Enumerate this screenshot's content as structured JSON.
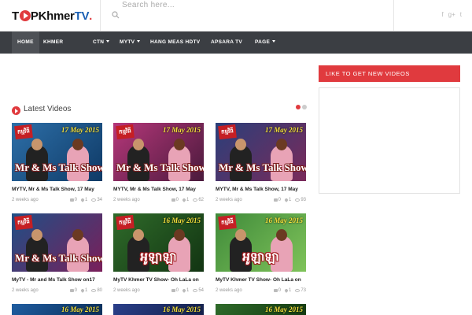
{
  "header": {
    "logo": {
      "part1": "T",
      "part2": "PKhmer",
      "part3": "TV",
      "part4": "."
    },
    "search_placeholder": "Search here...",
    "social": [
      "f",
      "g+",
      "t"
    ]
  },
  "nav": [
    {
      "label": "HOME",
      "active": true,
      "caret": false
    },
    {
      "label": "KHMER",
      "active": false,
      "caret": false
    },
    {
      "label": "CTN",
      "active": false,
      "caret": true
    },
    {
      "label": "MYTV",
      "active": false,
      "caret": true
    },
    {
      "label": "HANG MEAS HDTV",
      "active": false,
      "caret": false
    },
    {
      "label": "APSARA TV",
      "active": false,
      "caret": false
    },
    {
      "label": "PAGE",
      "active": false,
      "caret": true
    }
  ],
  "sidebar": {
    "widget_title": "LIKE TO GET NEW VIDEOS"
  },
  "latest": {
    "title": "Latest Videos",
    "videos": [
      {
        "title": "MYTV, Mr & Ms Talk Show, 17 May",
        "time": "2 weeks ago",
        "comments": "0",
        "likes": "1",
        "views": "34",
        "thumb_date": "17 May 2015",
        "thumb_text": "Mr & Ms Talk Show",
        "thumb_badge": "កម្មវិធី",
        "bg": "#2d6fa8",
        "bg2": "#0f3a66"
      },
      {
        "title": "MYTV, Mr & Ms Talk Show, 17 May",
        "time": "2 weeks ago",
        "comments": "0",
        "likes": "1",
        "views": "62",
        "thumb_date": "17 May 2015",
        "thumb_text": "Mr & Ms Talk Show",
        "thumb_badge": "កម្មវិធី",
        "bg": "#b5377a",
        "bg2": "#4a1a3c"
      },
      {
        "title": "MYTV, Mr & Ms Talk Show, 17 May",
        "time": "2 weeks ago",
        "comments": "0",
        "likes": "1",
        "views": "93",
        "thumb_date": "17 May 2015",
        "thumb_text": "Mr & Ms Talk Show",
        "thumb_badge": "កម្មវិធី",
        "bg": "#2a3f7a",
        "bg2": "#7a2a5a"
      },
      {
        "title": "MyTV - Mr and Ms Talk Show on17",
        "time": "2 weeks ago",
        "comments": "0",
        "likes": "1",
        "views": "80",
        "thumb_date": "",
        "thumb_text": "Mr & Ms Talk Show",
        "thumb_badge": "កម្មវិធី",
        "bg": "#1f4f86",
        "bg2": "#7a1f5a"
      },
      {
        "title": "MyTV Khmer TV Show- Oh LaLa on",
        "time": "2 weeks ago",
        "comments": "0",
        "likes": "1",
        "views": "54",
        "thumb_date": "16 May 2015",
        "thumb_text": "អូឡាឡា",
        "thumb_badge": "កម្មវិធី",
        "bg": "#2f6b2a",
        "bg2": "#123412"
      },
      {
        "title": "MyTV Khmer TV Show- Oh LaLa on",
        "time": "2 weeks ago",
        "comments": "0",
        "likes": "1",
        "views": "73",
        "thumb_date": "16 May 2015",
        "thumb_text": "អូឡាឡា",
        "thumb_badge": "កម្មវិធី",
        "bg": "#3f8a3a",
        "bg2": "#7fc35a"
      }
    ],
    "next_row_dates": [
      "16 May 2015",
      "16 May 2015",
      "16 May 2015"
    ]
  },
  "colors": {
    "accent": "#e03a3e",
    "nav_bg": "#3b3e43",
    "logo_blue": "#1a5fb4"
  }
}
